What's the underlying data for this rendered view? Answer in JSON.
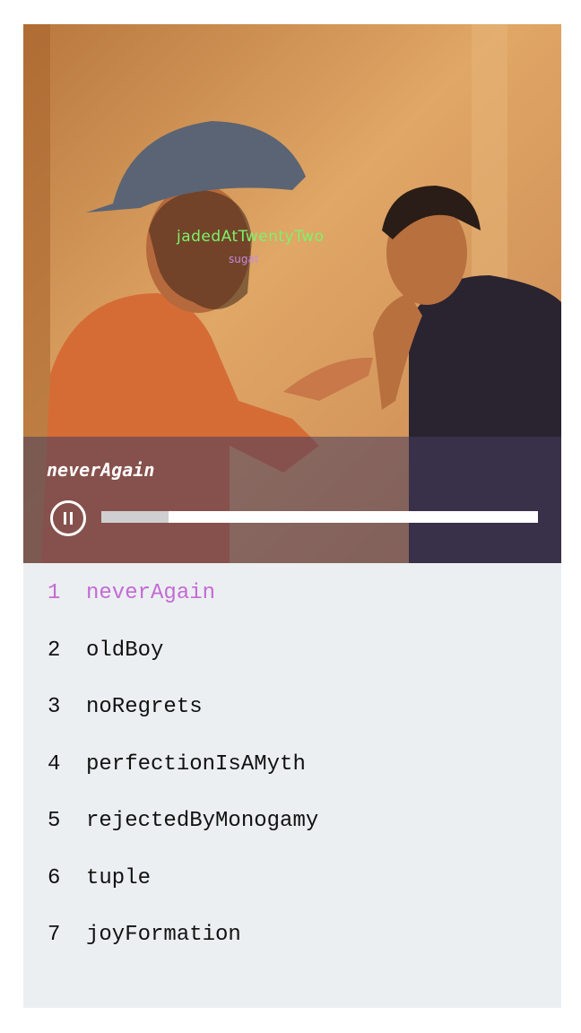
{
  "artwork": {
    "overlay_title": "jadedAtTwentyTwo",
    "overlay_artist": "sugat"
  },
  "now_playing": {
    "title": "neverAgain",
    "state": "playing",
    "progress_fraction": 0.155
  },
  "playlist": [
    {
      "number": "1",
      "title": "neverAgain",
      "active": true
    },
    {
      "number": "2",
      "title": "oldBoy",
      "active": false
    },
    {
      "number": "3",
      "title": "noRegrets",
      "active": false
    },
    {
      "number": "4",
      "title": "perfectionIsAMyth",
      "active": false
    },
    {
      "number": "5",
      "title": "rejectedByMonogamy",
      "active": false
    },
    {
      "number": "6",
      "title": "tuple",
      "active": false
    },
    {
      "number": "7",
      "title": "joyFormation",
      "active": false
    }
  ],
  "colors": {
    "active_track": "#c46ad6",
    "panel_background": "#eceff1",
    "overlay_title": "#7cf36a",
    "overlay_artist": "#c58be0"
  },
  "icons": {
    "play_state": "pause-icon"
  }
}
